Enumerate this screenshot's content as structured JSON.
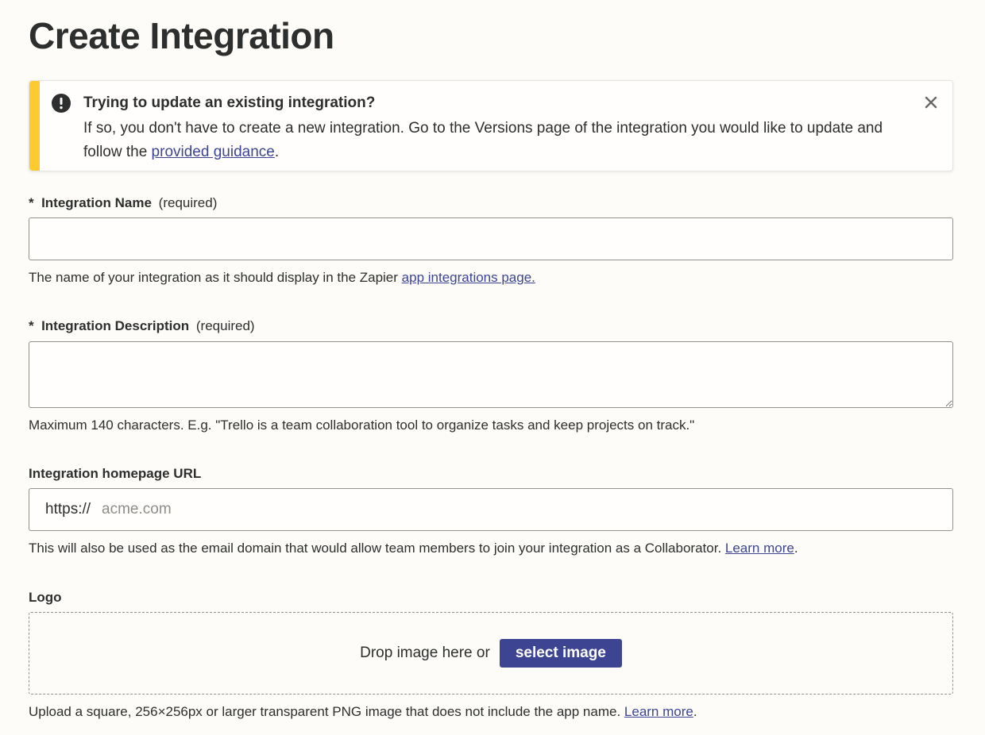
{
  "page": {
    "title": "Create Integration"
  },
  "alert": {
    "title": "Trying to update an existing integration?",
    "body_prefix": "If so, you don't have to create a new integration. Go to the Versions page of the integration you would like to update and follow the ",
    "link_text": "provided guidance",
    "body_suffix": ".",
    "accent_color": "#ffc930",
    "icon": "exclamation-circle-icon",
    "close_icon": "close-icon"
  },
  "fields": {
    "name": {
      "asterisk": "*",
      "label": "Integration Name",
      "required": "(required)",
      "value": "",
      "help_prefix": "The name of your integration as it should display in the Zapier ",
      "help_link": "app integrations page."
    },
    "description": {
      "asterisk": "*",
      "label": "Integration Description",
      "required": "(required)",
      "value": "",
      "help": "Maximum 140 characters. E.g. \"Trello is a team collaboration tool to organize tasks and keep projects on track.\""
    },
    "homepage": {
      "label": "Integration homepage URL",
      "prefix": "https://",
      "placeholder": "acme.com",
      "help_prefix": "This will also be used as the email domain that would allow team members to join your integration as a Collaborator. ",
      "help_link": "Learn more",
      "help_suffix": "."
    },
    "logo": {
      "label": "Logo",
      "drop_text": "Drop image here or",
      "button_label": "select image",
      "help_prefix": "Upload a square, 256×256px or larger transparent PNG image that does not include the app name. ",
      "help_link": "Learn more",
      "help_suffix": "."
    }
  },
  "colors": {
    "primary": "#3d4592",
    "background": "#fdfcf8",
    "text": "#2d2e2e"
  }
}
